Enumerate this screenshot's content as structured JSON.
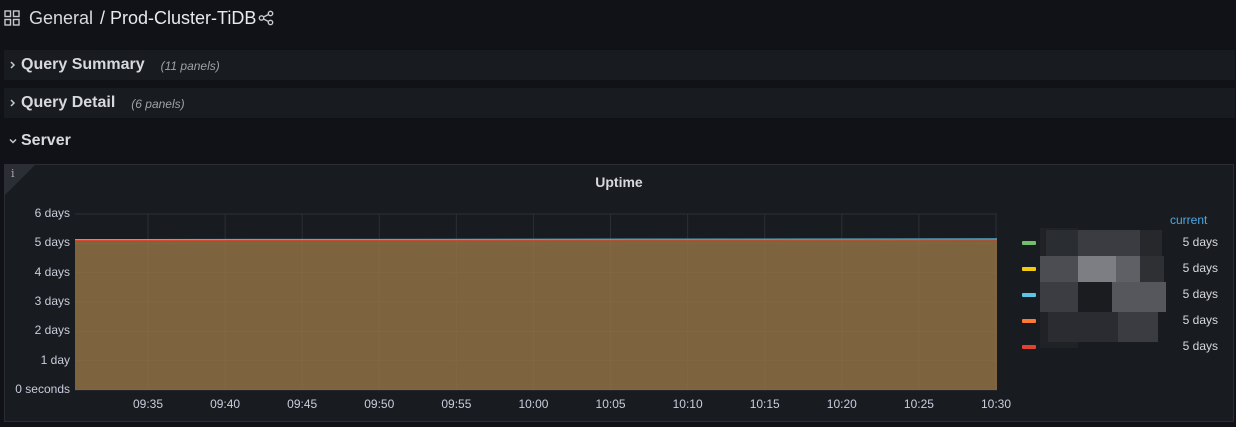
{
  "header": {
    "folder": "General",
    "title": "/ Prod-Cluster-TiDB",
    "icons": {
      "apps": "apps-grid-icon",
      "share": "share-icon"
    }
  },
  "rows": [
    {
      "title": "Query Summary",
      "count": "(11 panels)",
      "collapsed": true
    },
    {
      "title": "Query Detail",
      "count": "(6 panels)",
      "collapsed": true
    },
    {
      "title": "Server",
      "count": "",
      "collapsed": false
    }
  ],
  "panel": {
    "title": "Uptime",
    "info_icon": "info-icon"
  },
  "chart_data": {
    "type": "area",
    "title": "Uptime",
    "xlabel": "",
    "ylabel": "",
    "x": [
      "09:35",
      "09:40",
      "09:45",
      "09:50",
      "09:55",
      "10:00",
      "10:05",
      "10:10",
      "10:15",
      "10:20",
      "10:25",
      "10:30"
    ],
    "y_tick_labels": [
      "0 seconds",
      "1 day",
      "2 days",
      "3 days",
      "4 days",
      "5 days",
      "6 days"
    ],
    "ylim_days": [
      0,
      6
    ],
    "series": [
      {
        "color": "#73bf69",
        "start_days": 5.12,
        "end_days": 5.14
      },
      {
        "color": "#f2cc0c",
        "start_days": 5.11,
        "end_days": 5.13
      },
      {
        "color": "#5ec4e6",
        "start_days": 5.13,
        "end_days": 5.15
      },
      {
        "color": "#ff7833",
        "start_days": 5.11,
        "end_days": 5.13
      },
      {
        "color": "#e0422f",
        "start_days": 5.1,
        "end_days": 5.12
      }
    ],
    "legend": {
      "header": "current",
      "placement": "right",
      "entries": [
        {
          "color": "#73bf69",
          "value": "5 days"
        },
        {
          "color": "#f2cc0c",
          "value": "5 days"
        },
        {
          "color": "#5ec4e6",
          "value": "5 days"
        },
        {
          "color": "#ff7833",
          "value": "5 days"
        },
        {
          "color": "#e0422f",
          "value": "5 days"
        }
      ]
    },
    "grid": true
  }
}
